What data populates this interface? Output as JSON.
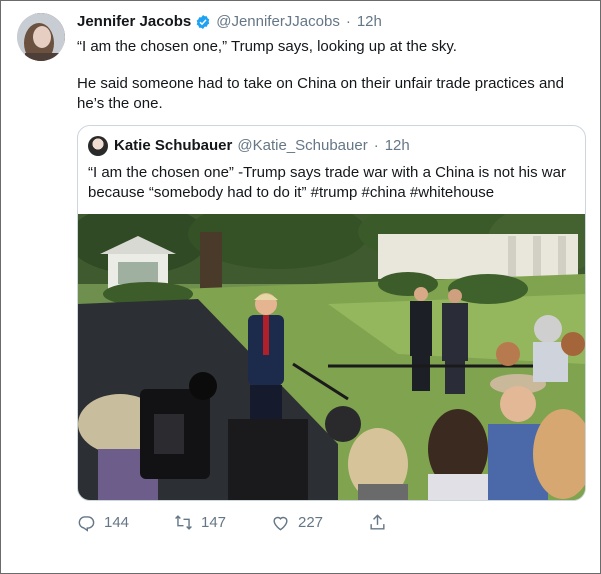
{
  "tweet": {
    "author": {
      "name": "Jennifer Jacobs",
      "handle": "@JenniferJJacobs",
      "verified_icon": "verified-badge-icon"
    },
    "time": "12h",
    "separator": "·",
    "paragraphs": [
      "“I am the chosen one,” Trump says, looking up at the sky.",
      "He said someone had to take on China on their unfair trade practices and he’s the one."
    ],
    "quoted": {
      "author": {
        "name": "Katie Schubauer",
        "handle": "@Katie_Schubauer"
      },
      "time": "12h",
      "text": "“I am the chosen one” -Trump says trade war with a China is not his war because “somebody had to do it” #trump #china #whitehouse"
    },
    "stats": {
      "replies": "144",
      "retweets": "147",
      "likes": "227"
    }
  },
  "colors": {
    "text": "#14171a",
    "secondary": "#657786",
    "verified": "#1da1f2",
    "border": "#ccd6dd"
  }
}
